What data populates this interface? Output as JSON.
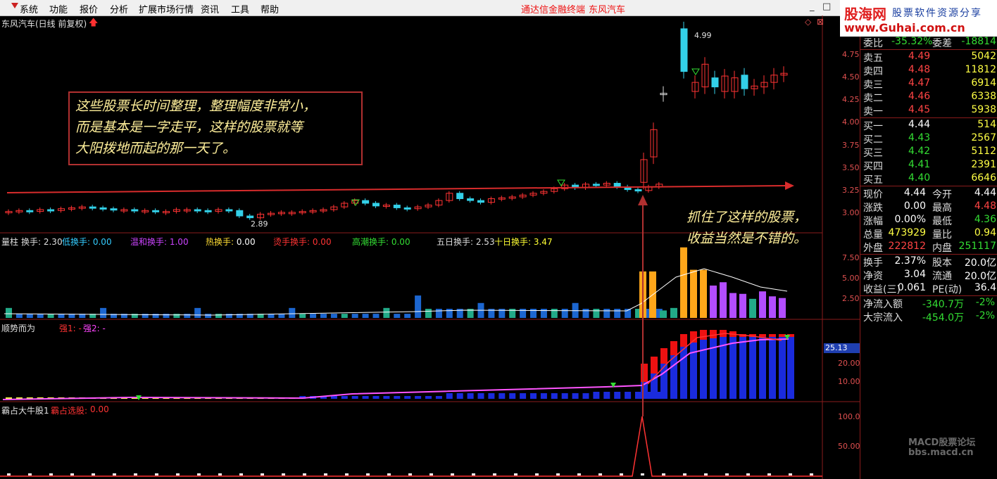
{
  "menu": {
    "items": [
      "系统",
      "功能",
      "报价",
      "分析",
      "扩展市场行情",
      "资讯",
      "工具",
      "帮助"
    ],
    "center_title": "通达信金融终端",
    "stock_title": "东风汽车"
  },
  "watermark": {
    "brand": "股海网",
    "tagline": "股票软件资源分享",
    "url": "www.Guhai.com.cn"
  },
  "watermark_bottom": {
    "line1": "MACD股票论坛",
    "line2": "bbs.macd.cn"
  },
  "chart_title": "东风汽车(日线 前复权)",
  "annotations": {
    "box": [
      "这些股票长时间整理，整理幅度非常小，",
      "而是基本是一字走平，这样的股票就等",
      "大阳拨地而起的那一天了。"
    ],
    "right": [
      "抓住了这样的股票，",
      "收益当然是不错的。"
    ]
  },
  "price_labels": {
    "high": "4.99",
    "low": "2.89"
  },
  "price_axis": [
    "4.75",
    "4.50",
    "4.25",
    "4.00",
    "3.75",
    "3.50",
    "3.25",
    "3.00"
  ],
  "vol_panel": {
    "title": "量柱",
    "items": [
      {
        "name": "换手",
        "value": "2.30",
        "name_color": "#dddddd",
        "value_color": "#dddddd"
      },
      {
        "name": "低换手",
        "value": "0.00",
        "name_color": "#33ccff",
        "value_color": "#33ccff"
      },
      {
        "name": "温和换手",
        "value": "1.00",
        "name_color": "#cc44ff",
        "value_color": "#cc44ff"
      },
      {
        "name": "热换手",
        "value": "0.00",
        "name_color": "#ffdd33",
        "value_color": "#ffffff"
      },
      {
        "name": "烫手换手",
        "value": "0.00",
        "name_color": "#ff3333",
        "value_color": "#ff3333"
      },
      {
        "name": "高潮换手",
        "value": "0.00",
        "name_color": "#33dd33",
        "value_color": "#33dd33"
      },
      {
        "name": "五日换手",
        "value": "2.53",
        "name_color": "#dddddd",
        "value_color": "#dddddd"
      },
      {
        "name": "十日换手",
        "value": "3.47",
        "name_color": "#ffff33",
        "value_color": "#ffff33"
      }
    ],
    "axis": [
      "7.50",
      "5.00",
      "2.50"
    ]
  },
  "trend_panel": {
    "title": "顺势而为",
    "s1": "强1: -",
    "s2": "强2: -",
    "axis": [
      "20.00",
      "10.00"
    ],
    "current": "25.13"
  },
  "bull_panel": {
    "title": "霸占大牛股1",
    "item": "霸占选股:",
    "value": "0.00",
    "axis": [
      "100.00",
      "50.00"
    ]
  },
  "quote": {
    "wei": {
      "l1": "委比",
      "v1": "-35.32%",
      "l2": "委差",
      "v2": "-18814"
    },
    "asks": [
      {
        "label": "卖五",
        "price": "4.49",
        "vol": "5042"
      },
      {
        "label": "卖四",
        "price": "4.48",
        "vol": "11812"
      },
      {
        "label": "卖三",
        "price": "4.47",
        "vol": "6914"
      },
      {
        "label": "卖二",
        "price": "4.46",
        "vol": "6338"
      },
      {
        "label": "卖一",
        "price": "4.45",
        "vol": "5938"
      }
    ],
    "bids": [
      {
        "label": "买一",
        "price": "4.44",
        "vol": "514"
      },
      {
        "label": "买二",
        "price": "4.43",
        "vol": "2567"
      },
      {
        "label": "买三",
        "price": "4.42",
        "vol": "5112"
      },
      {
        "label": "买四",
        "price": "4.41",
        "vol": "2391"
      },
      {
        "label": "买五",
        "price": "4.40",
        "vol": "6646"
      }
    ],
    "stats": [
      {
        "l1": "现价",
        "v1": "4.44",
        "c1": "#ffffff",
        "l2": "今开",
        "v2": "4.44",
        "c2": "#ffffff"
      },
      {
        "l1": "涨跌",
        "v1": "0.00",
        "c1": "#ffffff",
        "l2": "最高",
        "v2": "4.48",
        "c2": "#ff4444"
      },
      {
        "l1": "涨幅",
        "v1": "0.00%",
        "c1": "#ffffff",
        "l2": "最低",
        "v2": "4.36",
        "c2": "#33dd33"
      },
      {
        "l1": "总量",
        "v1": "473929",
        "c1": "#ffff44",
        "l2": "量比",
        "v2": "0.94",
        "c2": "#ffff44"
      },
      {
        "l1": "外盘",
        "v1": "222812",
        "c1": "#ff4444",
        "l2": "内盘",
        "v2": "251117",
        "c2": "#33dd33"
      }
    ],
    "fund": [
      {
        "l1": "换手",
        "v1": "2.37%",
        "l2": "股本",
        "v2": "20.0亿"
      },
      {
        "l1": "净资",
        "v1": "3.04",
        "l2": "流通",
        "v2": "20.0亿"
      },
      {
        "l1": "收益(三)",
        "v1": "0.061",
        "l2": "PE(动)",
        "v2": "36.4"
      }
    ],
    "flow": [
      {
        "label": "净流入额",
        "value": "-340.7万",
        "pct": "-2%"
      },
      {
        "label": "大宗流入",
        "value": "-454.0万",
        "pct": "-2%"
      }
    ]
  },
  "colors": {
    "up": "#ff3333",
    "down": "#33d0e8",
    "axis_frame": "#8a1b1b",
    "trendline": "#e03030"
  }
}
